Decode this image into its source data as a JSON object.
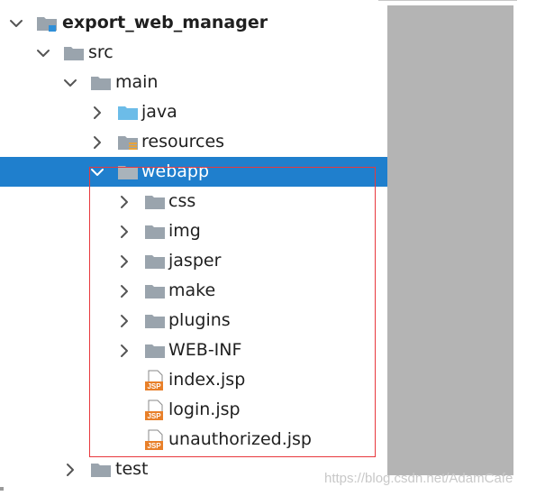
{
  "tree": {
    "items": [
      {
        "label": "export_web_manager",
        "kind": "module",
        "expanded": true,
        "selected": false
      },
      {
        "label": "src",
        "kind": "folder",
        "expanded": true,
        "selected": false
      },
      {
        "label": "main",
        "kind": "folder",
        "expanded": true,
        "selected": false
      },
      {
        "label": "java",
        "kind": "source-folder",
        "expanded": false,
        "selected": false
      },
      {
        "label": "resources",
        "kind": "resource-folder",
        "expanded": false,
        "selected": false
      },
      {
        "label": "webapp",
        "kind": "folder",
        "expanded": true,
        "selected": true
      },
      {
        "label": "css",
        "kind": "folder",
        "expanded": false,
        "selected": false
      },
      {
        "label": "img",
        "kind": "folder",
        "expanded": false,
        "selected": false
      },
      {
        "label": "jasper",
        "kind": "folder",
        "expanded": false,
        "selected": false
      },
      {
        "label": "make",
        "kind": "folder",
        "expanded": false,
        "selected": false
      },
      {
        "label": "plugins",
        "kind": "folder",
        "expanded": false,
        "selected": false
      },
      {
        "label": "WEB-INF",
        "kind": "folder",
        "expanded": false,
        "selected": false
      },
      {
        "label": "index.jsp",
        "kind": "jsp-file",
        "expanded": null,
        "selected": false
      },
      {
        "label": "login.jsp",
        "kind": "jsp-file",
        "expanded": null,
        "selected": false
      },
      {
        "label": "unauthorized.jsp",
        "kind": "jsp-file",
        "expanded": null,
        "selected": false
      },
      {
        "label": "test",
        "kind": "folder",
        "expanded": false,
        "selected": false
      }
    ]
  },
  "jsp_badge": "JSP",
  "watermark": "https://blog.csdn.net/AdamCafe",
  "colors": {
    "selection": "#1f7fcd",
    "highlight_border": "#e8383d",
    "folder": "#9aa4ad",
    "source_folder": "#6cbce8",
    "jsp_orange": "#e8802a",
    "side_panel": "#b4b4b4"
  }
}
